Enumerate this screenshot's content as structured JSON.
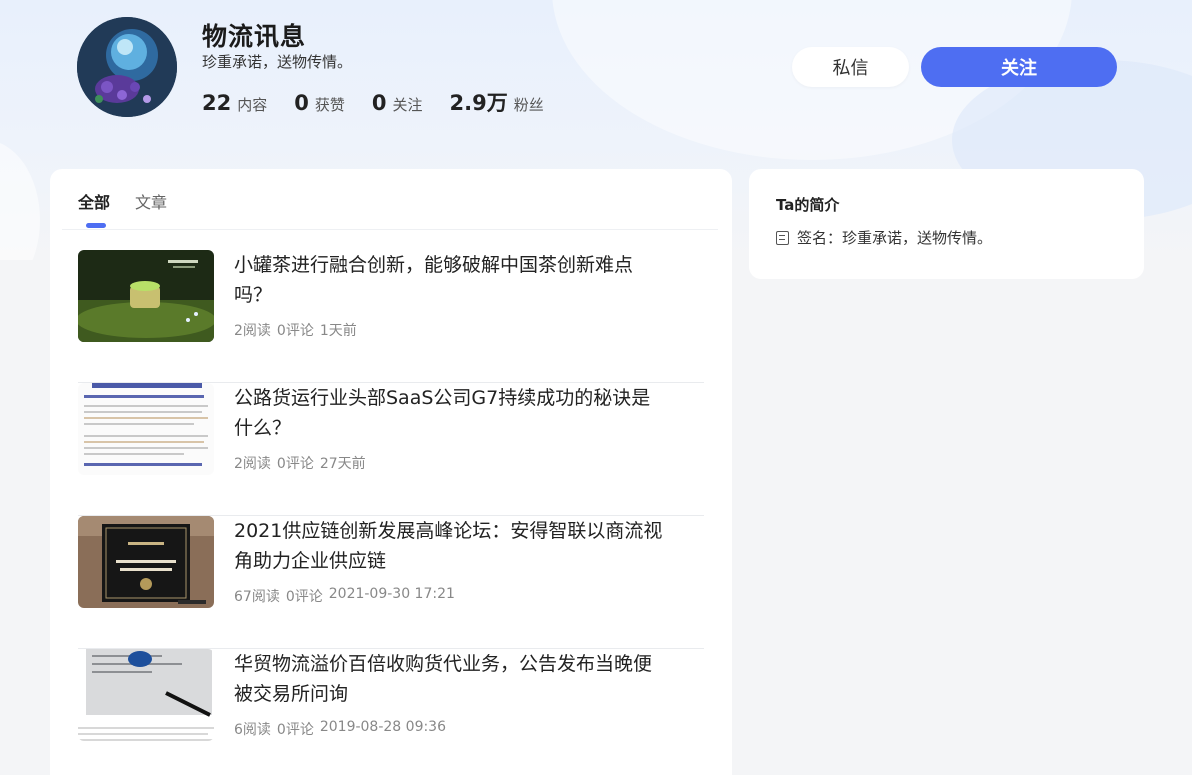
{
  "profile": {
    "name": "物流讯息",
    "motto": "珍重承诺，送物传情。",
    "stats": [
      {
        "num": "22",
        "label": "内容"
      },
      {
        "num": "0",
        "label": "获赞"
      },
      {
        "num": "0",
        "label": "关注"
      },
      {
        "num": "2.9万",
        "label": "粉丝"
      }
    ]
  },
  "actions": {
    "message_label": "私信",
    "follow_label": "关注"
  },
  "tabs": [
    {
      "label": "全部",
      "active": true
    },
    {
      "label": "文章",
      "active": false
    }
  ],
  "articles": [
    {
      "title": "小罐茶进行融合创新，能够破解中国茶创新难点吗？",
      "reads": "2阅读",
      "comments": "0评论",
      "time": "1天前",
      "thumb": "tea-product-photo"
    },
    {
      "title": "公路货运行业头部SaaS公司G7持续成功的秘诀是什么？",
      "reads": "2阅读",
      "comments": "0评论",
      "time": "27天前",
      "thumb": "text-document-photo"
    },
    {
      "title": "2021供应链创新发展高峰论坛：安得智联以商流视角助力企业供应链",
      "reads": "67阅读",
      "comments": "0评论",
      "time": "2021-09-30 17:21",
      "thumb": "award-plaque-photo"
    },
    {
      "title": "华贸物流溢价百倍收购货代业务，公告发布当晚便被交易所问询",
      "reads": "6阅读",
      "comments": "0评论",
      "time": "2019-08-28 09:36",
      "thumb": "newspaper-pen-photo"
    }
  ],
  "intro": {
    "title": "Ta的简介",
    "signature": "签名：珍重承诺，送物传情。"
  },
  "colors": {
    "accent": "#4e6ef2",
    "background": "#f4f5f7"
  }
}
